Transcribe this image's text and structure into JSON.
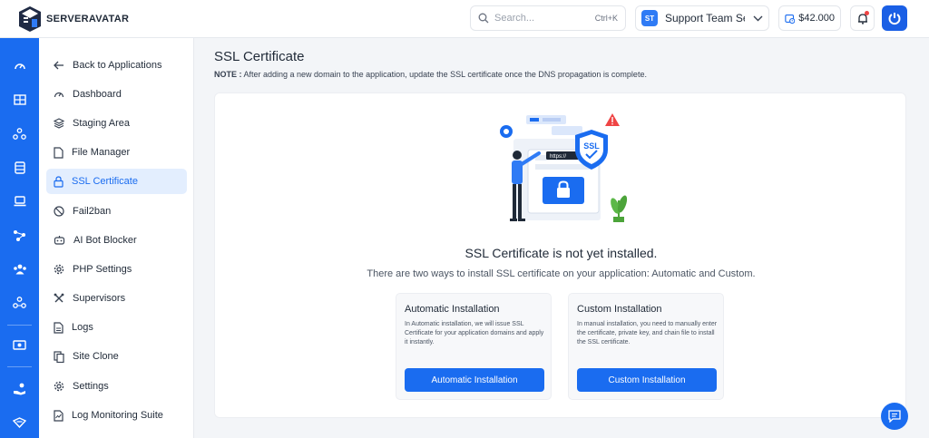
{
  "header": {
    "brand": "SERVERAVATAR",
    "search_placeholder": "Search...",
    "search_shortcut": "Ctrl+K",
    "team_initials": "ST",
    "team_name": "Support Team Se...",
    "balance": "$42.000"
  },
  "rail": {
    "icons": [
      "dashboard-icon",
      "server-list-icon",
      "cluster-icon",
      "database-icon",
      "storage-icon",
      "network-icon",
      "team-icon",
      "integrations-icon",
      "billing-icon",
      "donate-icon",
      "security-icon"
    ]
  },
  "sidebar": {
    "items": [
      {
        "label": "Back to Applications",
        "icon": "arrow-left-icon"
      },
      {
        "label": "Dashboard",
        "icon": "gauge-icon"
      },
      {
        "label": "Staging Area",
        "icon": "layers-icon"
      },
      {
        "label": "File Manager",
        "icon": "file-icon"
      },
      {
        "label": "SSL Certificate",
        "icon": "lock-icon",
        "active": true
      },
      {
        "label": "Fail2ban",
        "icon": "ban-icon"
      },
      {
        "label": "AI Bot Blocker",
        "icon": "bot-icon"
      },
      {
        "label": "PHP Settings",
        "icon": "gear-icon"
      },
      {
        "label": "Supervisors",
        "icon": "tools-icon"
      },
      {
        "label": "Logs",
        "icon": "log-icon"
      },
      {
        "label": "Site Clone",
        "icon": "copy-icon"
      },
      {
        "label": "Settings",
        "icon": "settings-icon"
      },
      {
        "label": "Log Monitoring Suite",
        "icon": "monitor-icon"
      }
    ]
  },
  "main": {
    "title": "SSL Certificate",
    "note_label": "NOTE :",
    "note_text": " After adding a new domain to the application, update the SSL certificate once the DNS propagation is complete.",
    "illustration": {
      "badge": "SSL",
      "url_text": "https://"
    },
    "heading": "SSL Certificate is not yet installed.",
    "subtext": "There are two ways to install SSL certificate on your application: Automatic and Custom.",
    "options": [
      {
        "title": "Automatic Installation",
        "description": "In Automatic installation, we will issue SSL Certificate for your application domains and apply it instantly.",
        "button": "Automatic Installation"
      },
      {
        "title": "Custom Installation",
        "description": "In manual installation, you need to manually enter the certificate, private key, and chain file to install the SSL certificate.",
        "button": "Custom Installation"
      }
    ]
  },
  "colors": {
    "accent": "#1a6cf0",
    "active_bg": "#e3eefe",
    "alert": "#ef4444"
  }
}
